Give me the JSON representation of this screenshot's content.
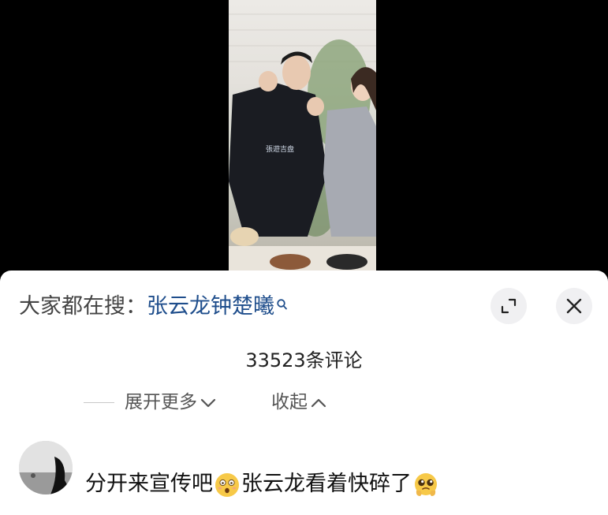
{
  "search_hint": {
    "prefix": "大家都在搜：",
    "keyword": "张云龙钟楚曦"
  },
  "video": {
    "shirt_text": "張遊吉盘"
  },
  "comments_header": {
    "count_label": "33523条评论"
  },
  "reply_controls": {
    "expand_label": "展开更多",
    "collapse_label": "收起"
  },
  "comment": {
    "text_part1": "分开来宣传吧",
    "text_part2": "张云龙看着快碎了"
  },
  "icons": {
    "search": "magnifier-icon",
    "expand": "fullscreen-icon",
    "close": "close-icon",
    "emoji1": "dizzy-face-emoji",
    "emoji2": "pleading-face-emoji"
  },
  "colors": {
    "keyword": "#1f4e8c",
    "sheet_bg": "#ffffff",
    "button_bg": "#f0f0f2",
    "emoji_yellow": "#f7c948"
  }
}
